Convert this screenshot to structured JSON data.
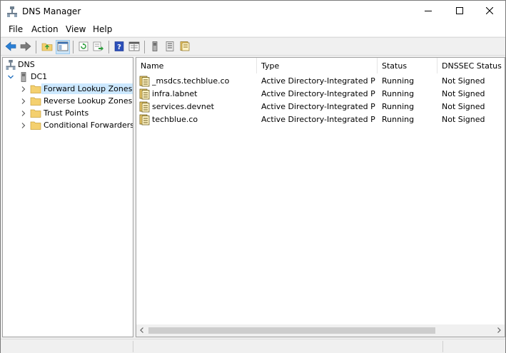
{
  "window": {
    "title": "DNS Manager"
  },
  "menu": [
    "File",
    "Action",
    "View",
    "Help"
  ],
  "tree": {
    "root": "DNS",
    "server": "DC1",
    "children": [
      "Forward Lookup Zones",
      "Reverse Lookup Zones",
      "Trust Points",
      "Conditional Forwarders"
    ],
    "selected": "Forward Lookup Zones"
  },
  "list": {
    "columns": [
      "Name",
      "Type",
      "Status",
      "DNSSEC Status"
    ],
    "rows": [
      {
        "name": "_msdcs.techblue.co",
        "type": "Active Directory-Integrated Pr...",
        "status": "Running",
        "dnssec": "Not Signed"
      },
      {
        "name": "infra.labnet",
        "type": "Active Directory-Integrated Pr...",
        "status": "Running",
        "dnssec": "Not Signed"
      },
      {
        "name": "services.devnet",
        "type": "Active Directory-Integrated Pr...",
        "status": "Running",
        "dnssec": "Not Signed"
      },
      {
        "name": "techblue.co",
        "type": "Active Directory-Integrated Pr...",
        "status": "Running",
        "dnssec": "Not Signed"
      }
    ]
  },
  "colors": {
    "selection": "#cce8ff",
    "accent_blue": "#1f6fbf",
    "folder": "#f4d06f"
  },
  "icons": {
    "toolbar": [
      "back-arrow-icon",
      "forward-arrow-icon",
      "up-folder-icon",
      "show-hide-tree-icon",
      "refresh-icon",
      "export-list-icon",
      "help-icon",
      "properties-icon",
      "server-icon",
      "list-icon",
      "zone-icon"
    ]
  }
}
